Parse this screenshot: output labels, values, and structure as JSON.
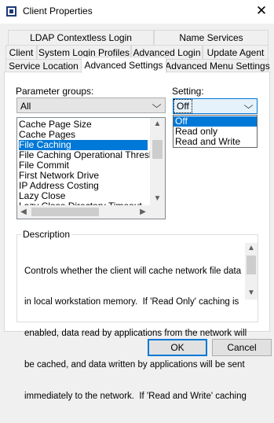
{
  "window": {
    "title": "Client Properties",
    "close_icon": "close-icon"
  },
  "tabs": {
    "row1": [
      "LDAP Contextless Login",
      "Name Services"
    ],
    "row2": [
      "Client",
      "System Login Profiles",
      "Advanced Login",
      "Update Agent"
    ],
    "row3": [
      "Service Location",
      "Advanced Settings",
      "Advanced Menu Settings"
    ],
    "active": "Advanced Settings"
  },
  "parameter_groups": {
    "label": "Parameter groups:",
    "value": "All"
  },
  "parameters": {
    "items": [
      "Cache Page Size",
      "Cache Pages",
      "File Caching",
      "File Caching Operational Threshold",
      "File Commit",
      "First Network Drive",
      "IP Address Costing",
      "Lazy Close",
      "Lazy Close Directory Timeout"
    ],
    "selected": "File Caching"
  },
  "setting": {
    "label": "Setting:",
    "value": "Off",
    "options": [
      "Off",
      "Read only",
      "Read and Write"
    ]
  },
  "description": {
    "label": "Description",
    "lines": [
      "Controls whether the client will cache network file data",
      "in local workstation memory.  If 'Read Only' caching is",
      "enabled, data read by applications from the network will",
      "be cached, and data written by applications will be sent",
      "immediately to the network.  If 'Read and Write' caching"
    ]
  },
  "buttons": {
    "ok": "OK",
    "cancel": "Cancel"
  },
  "colors": {
    "accent": "#0078d7",
    "window_bg": "#f0f0f0"
  }
}
